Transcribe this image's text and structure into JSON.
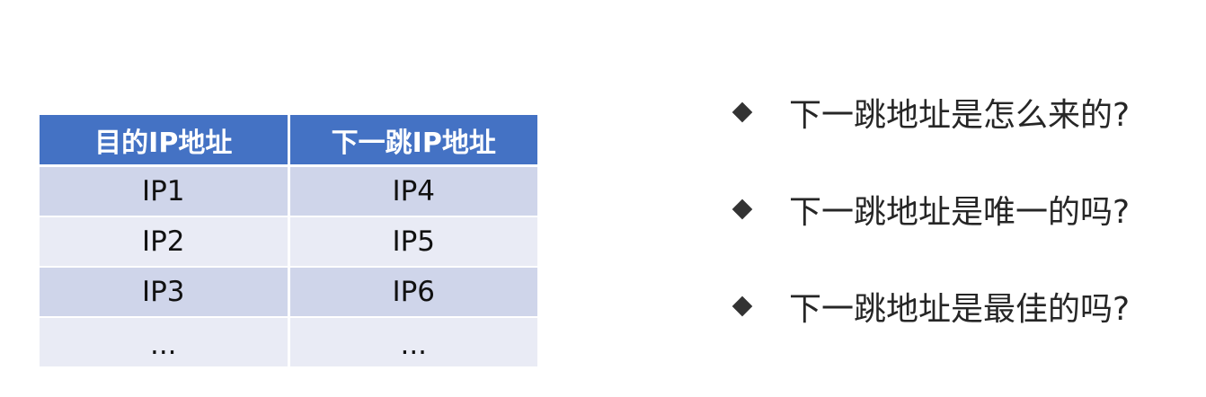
{
  "table": {
    "headers": [
      "目的IP地址",
      "下一跳IP地址"
    ],
    "rows": [
      [
        "IP1",
        "IP4"
      ],
      [
        "IP2",
        "IP5"
      ],
      [
        "IP3",
        "IP6"
      ],
      [
        "...",
        "..."
      ]
    ],
    "header_color": "#4472c4",
    "row_color_odd": "#cfd5ea",
    "row_color_even": "#e9ebf5"
  },
  "questions": [
    {
      "icon": "diamond-bullet",
      "text": "下一跳地址是怎么来的?"
    },
    {
      "icon": "diamond-bullet",
      "text": "下一跳地址是唯一的吗?"
    },
    {
      "icon": "diamond-bullet",
      "text": "下一跳地址是最佳的吗?"
    }
  ]
}
